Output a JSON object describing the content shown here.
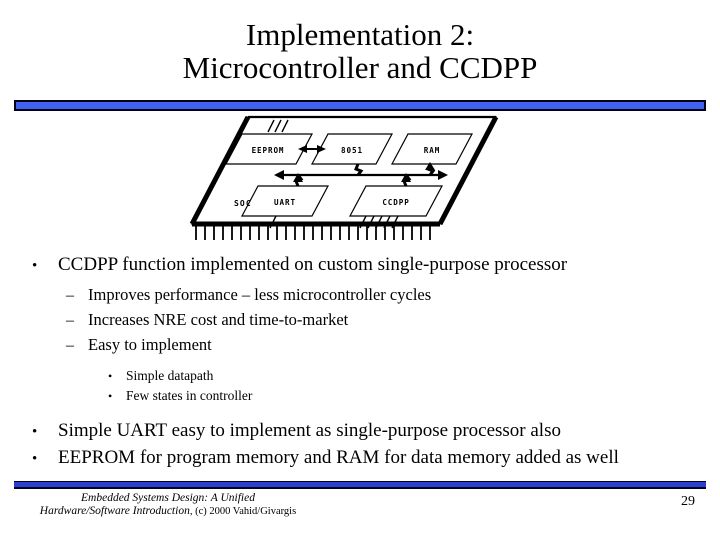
{
  "slide": {
    "title_line1": "Implementation 2:",
    "title_line2": "Microcontroller and CCDPP",
    "accent_color": "#3f62f0",
    "accent_color_bottom": "#2a3fd0",
    "page_number": "29"
  },
  "diagram": {
    "name": "soc-chip-diagram",
    "chip_label": "SOC",
    "blocks": [
      {
        "id": "eeprom",
        "label": "EEPROM"
      },
      {
        "id": "8051",
        "label": "8051"
      },
      {
        "id": "ram",
        "label": "RAM"
      },
      {
        "id": "uart",
        "label": "UART"
      },
      {
        "id": "ccdpp",
        "label": "CCDPP"
      }
    ]
  },
  "bullets": {
    "level1_a": "CCDPP function implemented on custom single-purpose processor",
    "level2": [
      "Improves performance – less microcontroller cycles",
      "Increases NRE cost and time-to-market",
      "Easy to implement"
    ],
    "level3": [
      "Simple datapath",
      "Few states in controller"
    ],
    "level1_b": "Simple UART easy to implement as single-purpose processor also",
    "level1_c": "EEPROM for program memory and RAM for data memory added as well",
    "marker_l1": "•",
    "marker_l2": "–",
    "marker_l3": "•"
  },
  "footer": {
    "line1": "Embedded Systems Design: A Unified",
    "line2_italic": "Hardware/Software Introduction",
    "line2_rest": ", (c) 2000 Vahid/Givargis"
  }
}
